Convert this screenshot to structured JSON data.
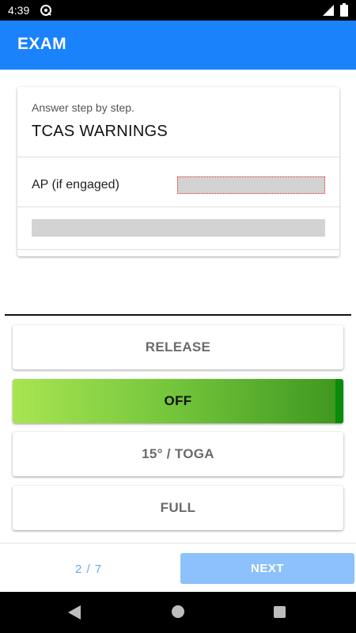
{
  "status_bar": {
    "time": "4:39"
  },
  "app_bar": {
    "title": "EXAM"
  },
  "card": {
    "hint": "Answer step by step.",
    "title": "TCAS WARNINGS",
    "steps": [
      {
        "label": "AP (if engaged)"
      }
    ]
  },
  "options": [
    {
      "label": "RELEASE",
      "selected": false
    },
    {
      "label": "OFF",
      "selected": true
    },
    {
      "label": "15° / TOGA",
      "selected": false
    },
    {
      "label": "FULL",
      "selected": false
    }
  ],
  "footer": {
    "page_indicator": "2 / 7",
    "next_label": "NEXT"
  },
  "colors": {
    "primary": "#1a82fb",
    "next_button": "#8cc1fb",
    "selected_option": "#72c43a",
    "selected_edge": "#0a8a08",
    "blank_highlight": "#e22222"
  },
  "icons": {
    "status_app": "sync-icon",
    "signal": "cell-signal-icon",
    "battery": "battery-icon",
    "nav_back": "back-triangle-icon",
    "nav_home": "home-circle-icon",
    "nav_recents": "recents-square-icon"
  }
}
